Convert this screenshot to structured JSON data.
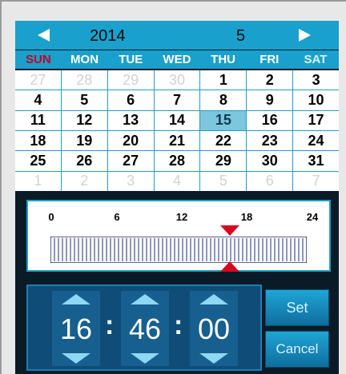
{
  "header": {
    "year": "2014",
    "month": "5"
  },
  "weekdays": [
    "SUN",
    "MON",
    "TUE",
    "WED",
    "THU",
    "FRI",
    "SAT"
  ],
  "days": [
    {
      "label": "27",
      "other": true
    },
    {
      "label": "28",
      "other": true
    },
    {
      "label": "29",
      "other": true
    },
    {
      "label": "30",
      "other": true
    },
    {
      "label": "1"
    },
    {
      "label": "2"
    },
    {
      "label": "3"
    },
    {
      "label": "4"
    },
    {
      "label": "5"
    },
    {
      "label": "6"
    },
    {
      "label": "7"
    },
    {
      "label": "8"
    },
    {
      "label": "9"
    },
    {
      "label": "10"
    },
    {
      "label": "11"
    },
    {
      "label": "12"
    },
    {
      "label": "13"
    },
    {
      "label": "14"
    },
    {
      "label": "15",
      "selected": true
    },
    {
      "label": "16"
    },
    {
      "label": "17"
    },
    {
      "label": "18"
    },
    {
      "label": "19"
    },
    {
      "label": "20"
    },
    {
      "label": "21"
    },
    {
      "label": "22"
    },
    {
      "label": "23"
    },
    {
      "label": "24"
    },
    {
      "label": "25"
    },
    {
      "label": "26"
    },
    {
      "label": "27"
    },
    {
      "label": "28"
    },
    {
      "label": "29"
    },
    {
      "label": "30"
    },
    {
      "label": "31"
    },
    {
      "label": "1",
      "other": true
    },
    {
      "label": "2",
      "other": true
    },
    {
      "label": "3",
      "other": true
    },
    {
      "label": "4",
      "other": true
    },
    {
      "label": "5",
      "other": true
    },
    {
      "label": "6",
      "other": true
    },
    {
      "label": "7",
      "other": true
    }
  ],
  "ruler": {
    "tick_labels": [
      "0",
      "6",
      "12",
      "18",
      "24"
    ],
    "marker_hour": 18,
    "marker_color": "#d6081e"
  },
  "time": {
    "hour": "16",
    "minute": "46",
    "second": "00"
  },
  "buttons": {
    "set": "Set",
    "cancel": "Cancel"
  },
  "colors": {
    "header_bg": "#1aa0cc",
    "sunday": "#c40028",
    "selected_day": "#7cc6de",
    "spinner_bg": "#0f4d78"
  },
  "icons": {
    "prev": "triangle-left-icon",
    "next": "triangle-right-icon",
    "spin_up": "triangle-up-icon",
    "spin_down": "triangle-down-icon"
  }
}
